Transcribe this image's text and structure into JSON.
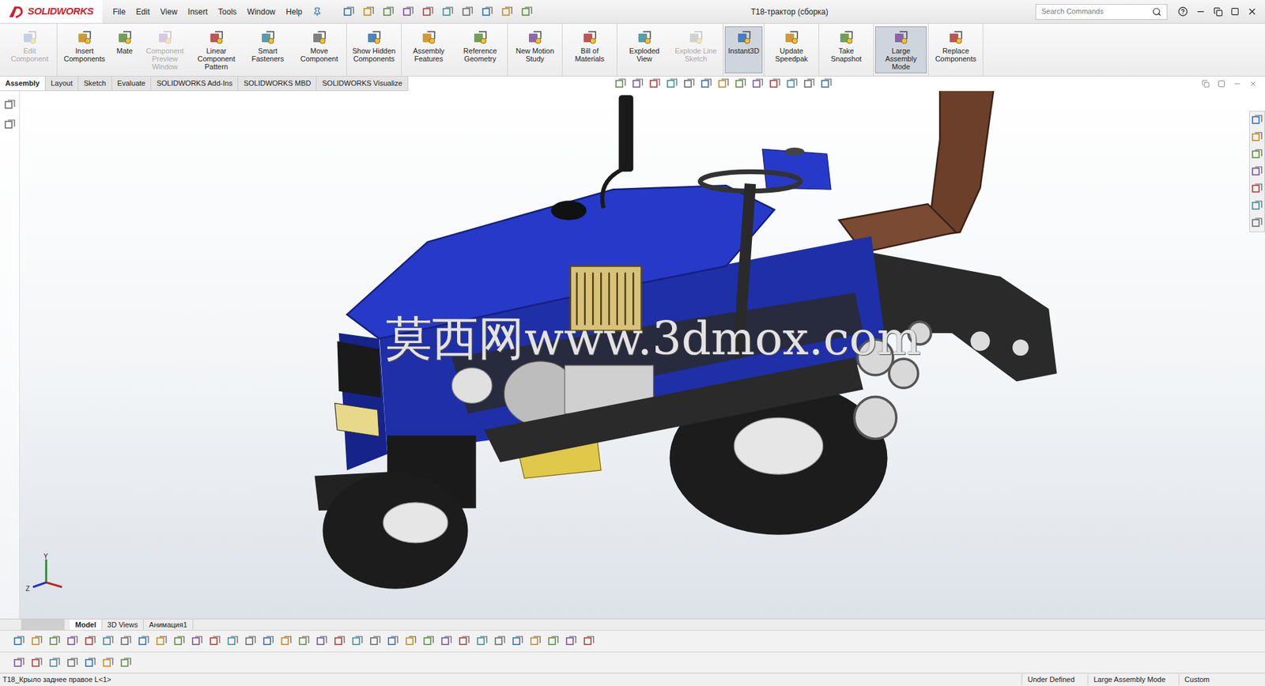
{
  "app": {
    "logo": "SOLIDWORKS"
  },
  "menus": [
    "File",
    "Edit",
    "View",
    "Insert",
    "Tools",
    "Window",
    "Help"
  ],
  "window": {
    "title": "T18-трактор (сборка)"
  },
  "search": {
    "placeholder": "Search Commands"
  },
  "ribbon": [
    {
      "buttons": [
        {
          "label": "Edit Component",
          "disabled": true,
          "selected": false
        }
      ]
    },
    {
      "buttons": [
        {
          "label": "Insert Components",
          "disabled": false,
          "selected": false
        },
        {
          "label": "Mate",
          "disabled": false,
          "selected": false
        },
        {
          "label": "Component Preview Window",
          "disabled": true,
          "selected": false
        },
        {
          "label": "Linear Component Pattern",
          "disabled": false,
          "selected": false
        },
        {
          "label": "Smart Fasteners",
          "disabled": false,
          "selected": false
        },
        {
          "label": "Move Component",
          "disabled": false,
          "selected": false
        }
      ]
    },
    {
      "buttons": [
        {
          "label": "Show Hidden Components",
          "disabled": false,
          "selected": false
        }
      ]
    },
    {
      "buttons": [
        {
          "label": "Assembly Features",
          "disabled": false,
          "selected": false
        },
        {
          "label": "Reference Geometry",
          "disabled": false,
          "selected": false
        }
      ]
    },
    {
      "buttons": [
        {
          "label": "New Motion Study",
          "disabled": false,
          "selected": false
        }
      ]
    },
    {
      "buttons": [
        {
          "label": "Bill of Materials",
          "disabled": false,
          "selected": false
        }
      ]
    },
    {
      "buttons": [
        {
          "label": "Exploded View",
          "disabled": false,
          "selected": false
        },
        {
          "label": "Explode Line Sketch",
          "disabled": true,
          "selected": false
        }
      ]
    },
    {
      "buttons": [
        {
          "label": "Instant3D",
          "disabled": false,
          "selected": true
        }
      ]
    },
    {
      "buttons": [
        {
          "label": "Update Speedpak",
          "disabled": false,
          "selected": false
        }
      ]
    },
    {
      "buttons": [
        {
          "label": "Take Snapshot",
          "disabled": false,
          "selected": false
        }
      ]
    },
    {
      "buttons": [
        {
          "label": "Large Assembly Mode",
          "disabled": false,
          "selected": true
        }
      ]
    },
    {
      "buttons": [
        {
          "label": "Replace Components",
          "disabled": false,
          "selected": false
        }
      ]
    }
  ],
  "tabs": [
    {
      "label": "Assembly",
      "selected": true
    },
    {
      "label": "Layout",
      "selected": false
    },
    {
      "label": "Sketch",
      "selected": false
    },
    {
      "label": "Evaluate",
      "selected": false
    },
    {
      "label": "SOLIDWORKS Add-Ins",
      "selected": false
    },
    {
      "label": "SOLIDWORKS MBD",
      "selected": false
    },
    {
      "label": "SOLIDWORKS Visualize",
      "selected": false
    }
  ],
  "viewport": {
    "watermark": "莫西网www.3dmox.com",
    "triad": [
      "Y",
      "Z"
    ]
  },
  "bottom_tabs": [
    {
      "label": "Model",
      "selected": true
    },
    {
      "label": "3D Views",
      "selected": false
    },
    {
      "label": "Анимация1",
      "selected": false
    }
  ],
  "status_bar": {
    "selection": "T18_Крыло заднее правое L<1>",
    "items": [
      "Under Defined",
      "Large Assembly Mode",
      "Custom"
    ]
  }
}
